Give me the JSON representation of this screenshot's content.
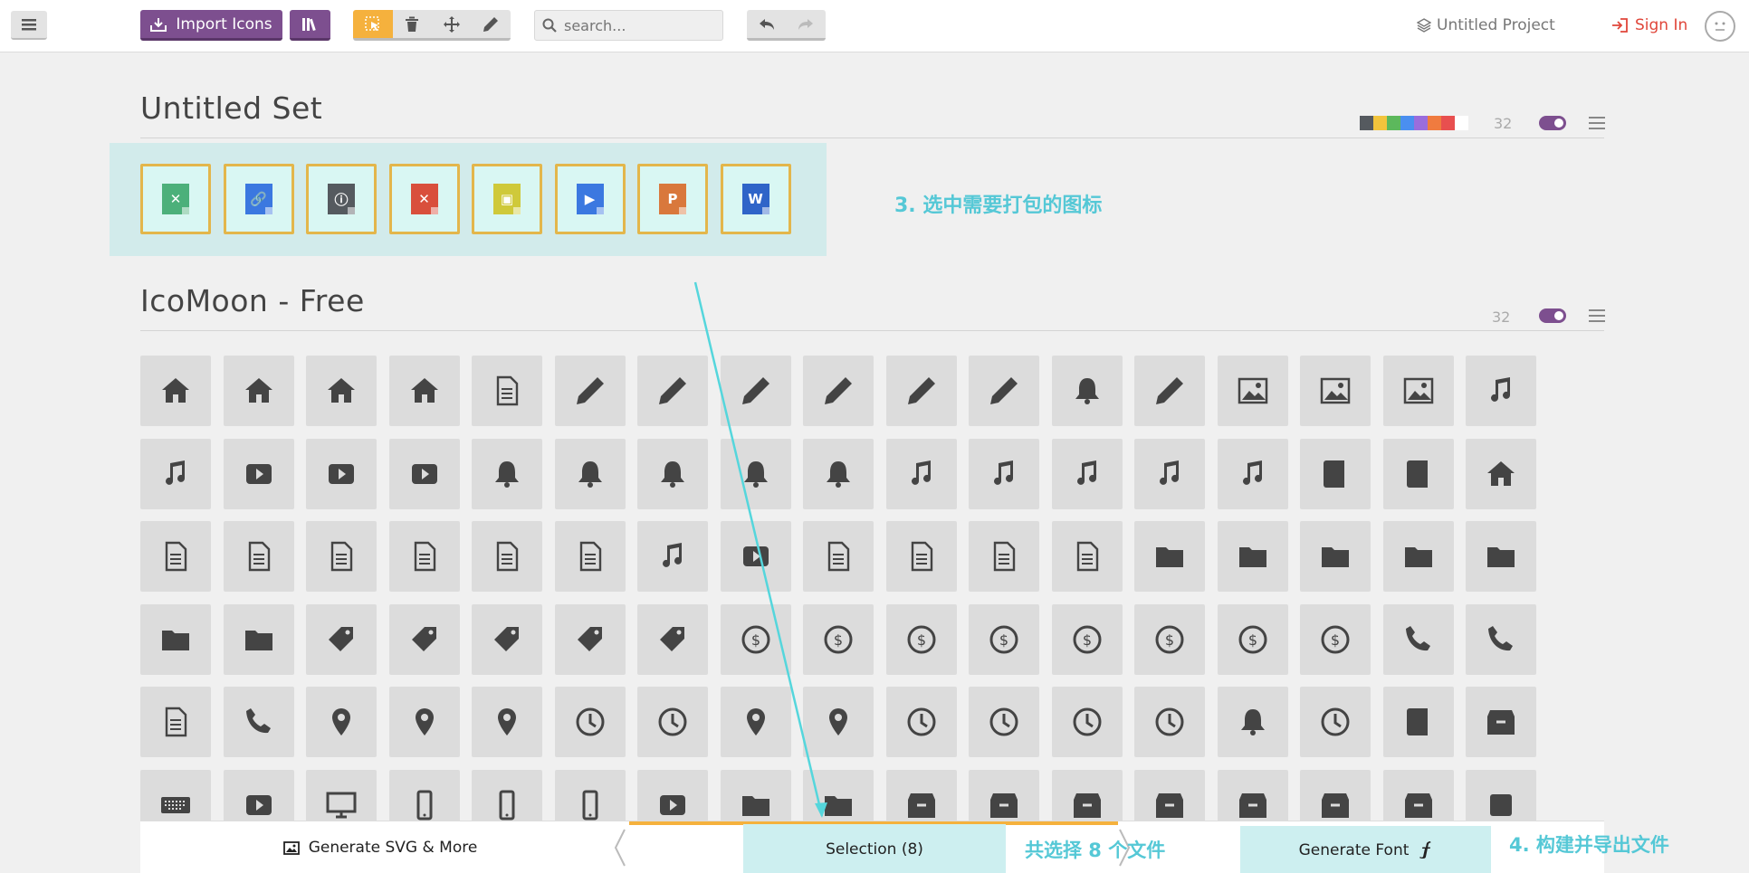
{
  "toolbar": {
    "menu_icon": "hamburger-icon",
    "import_label": "Import Icons",
    "import_icon": "import-icon",
    "library_icon": "library-icon",
    "tools": [
      "select-icon",
      "trash-icon",
      "move-icon",
      "pencil-icon"
    ],
    "active_tool": "select-icon",
    "search_placeholder": "search...",
    "undo_icon": "undo-icon",
    "redo_icon": "redo-icon",
    "project_label": "Untitled Project",
    "signin_label": "Sign In"
  },
  "sets": [
    {
      "title": "Untitled Set",
      "size": "32",
      "swatch_colors": [
        "#555a5f",
        "#f2c43c",
        "#5cb85c",
        "#4a8ff0",
        "#9a6ddc",
        "#f07b3f",
        "#e84f4f",
        "#ffffff"
      ],
      "selected_icons": [
        {
          "name": "file-excel-icon",
          "color": "#4cb07a",
          "glyph": "✕"
        },
        {
          "name": "file-link-icon",
          "color": "#3b78e0",
          "glyph": "🔗"
        },
        {
          "name": "file-info-icon",
          "color": "#555a5f",
          "glyph": "ⓘ"
        },
        {
          "name": "file-pdf-icon",
          "color": "#d94f3c",
          "glyph": "✕"
        },
        {
          "name": "file-image-icon",
          "color": "#cfc93a",
          "glyph": "▣"
        },
        {
          "name": "file-video-icon",
          "color": "#3b78e0",
          "glyph": "▶"
        },
        {
          "name": "file-powerpoint-icon",
          "color": "#d9783c",
          "glyph": "P"
        },
        {
          "name": "file-word-icon",
          "color": "#2f64c8",
          "glyph": "W"
        }
      ]
    },
    {
      "title": "IcoMoon - Free",
      "size": "32"
    }
  ],
  "icon_grid": [
    [
      "home-icon",
      "home2-icon",
      "home3-icon",
      "office-icon",
      "newspaper-icon",
      "pencil-icon",
      "pencil2-icon",
      "quill-icon",
      "pen-icon",
      "blog-icon",
      "eyedropper-icon",
      "droplet-icon",
      "paint-format-icon",
      "image-icon",
      "images-icon",
      "camera-icon",
      "headphones-icon"
    ],
    [
      "music-icon",
      "play-icon",
      "film-icon",
      "video-camera-icon",
      "dice-icon",
      "pacman-icon",
      "spades-icon",
      "clubs-icon",
      "diamonds-icon",
      "bullhorn-icon",
      "connection-icon",
      "podcast-icon",
      "feed-icon",
      "mic-icon",
      "book-icon",
      "books-icon",
      "library-icon"
    ],
    [
      "file-text-icon",
      "profile-icon",
      "file-empty-icon",
      "files-empty-icon",
      "file-text2-icon",
      "file-picture-icon",
      "file-music-icon",
      "file-play-icon",
      "file-video-icon",
      "file-zip-icon",
      "copy-icon",
      "paste-icon",
      "stack-icon",
      "folder-icon",
      "folder-open-icon",
      "folder-plus-icon",
      "folder-minus-icon"
    ],
    [
      "folder-download-icon",
      "folder-upload-icon",
      "price-tag-icon",
      "price-tags-icon",
      "barcode-icon",
      "qrcode-icon",
      "ticket-icon",
      "cart-icon",
      "coin-dollar-icon",
      "coin-euro-icon",
      "coin-pound-icon",
      "coin-yen-icon",
      "credit-card-icon",
      "calculator-icon",
      "lifebuoy-icon",
      "phone-icon",
      "phone-hang-up-icon"
    ],
    [
      "address-book-icon",
      "envelop-icon",
      "pushpin-icon",
      "location-icon",
      "location2-icon",
      "compass-icon",
      "compass2-icon",
      "map-icon",
      "map2-icon",
      "history-icon",
      "clock-icon",
      "clock2-icon",
      "alarm-icon",
      "bell-icon",
      "stopwatch-icon",
      "calendar-icon",
      "printer-icon"
    ],
    [
      "keyboard-icon",
      "display-icon",
      "laptop-icon",
      "mobile-icon",
      "mobile2-icon",
      "tablet-icon",
      "tv-icon",
      "drawer-icon",
      "drawer2-icon",
      "box-add-icon",
      "box-remove-icon",
      "download-icon",
      "upload-icon",
      "floppy-disk-icon",
      "drive-icon",
      "database-icon",
      "undo-icon"
    ]
  ],
  "annotations": {
    "step3": "3. 选中需要打包的图标",
    "count": "共选择 8 个文件",
    "step4": "4. 构建并导出文件"
  },
  "bottom": {
    "generate_svg_label": "Generate SVG & More",
    "generate_svg_icon": "image-icon",
    "selection_label": "Selection (8)",
    "generate_font_label": "Generate Font",
    "generate_font_icon": "font-f-icon"
  }
}
